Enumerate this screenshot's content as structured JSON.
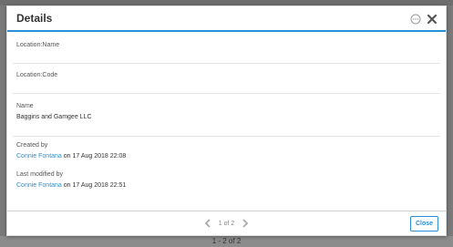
{
  "dialog": {
    "title": "Details"
  },
  "fields": {
    "location_name_label": "Location:Name",
    "location_code_label": "Location:Code",
    "name_label": "Name",
    "name_value": "Baggins and Gamgee LLC",
    "created_by_label": "Created by",
    "created_by_user": "Connie Fontana",
    "created_on_text": "on  17 Aug 2018 22:08",
    "modified_by_label": "Last modified by",
    "modified_by_user": "Connie Fontana",
    "modified_on_text": "on  17 Aug 2018 22:51"
  },
  "footer": {
    "pager_text": "1 of 2",
    "close_label": "Close"
  },
  "background": {
    "count_text": "1 - 2 of 2"
  },
  "colors": {
    "accent": "#2a8fd6"
  },
  "icons": {
    "more": "more-icon",
    "close": "close-icon",
    "prev": "chevron-left-icon",
    "next": "chevron-right-icon"
  }
}
